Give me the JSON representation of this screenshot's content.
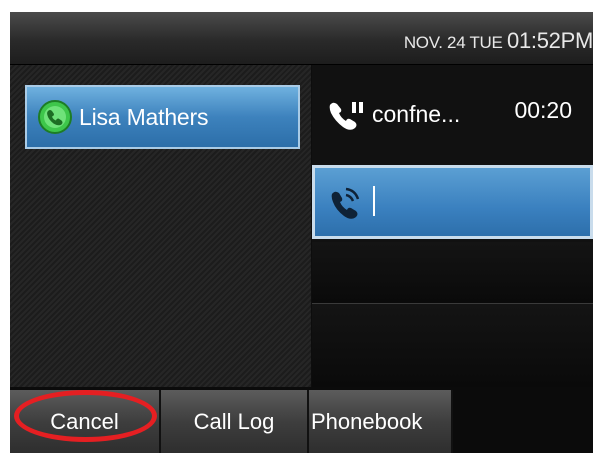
{
  "status_bar": {
    "date": "NOV. 24 TUE",
    "time": "01:52PM"
  },
  "contact": {
    "name": "Lisa Mathers",
    "icon": "presence-phone-icon",
    "icon_color": "#3ec64b"
  },
  "active_call": {
    "name": "confne...",
    "timer": "00:20",
    "icon": "handset-pause-icon"
  },
  "dial_line": {
    "icon": "handset-dialing-icon",
    "value": ""
  },
  "softkeys": {
    "cancel": "Cancel",
    "call_log": "Call Log",
    "phonebook": "Phonebook"
  },
  "highlight_color": "#e51f22"
}
